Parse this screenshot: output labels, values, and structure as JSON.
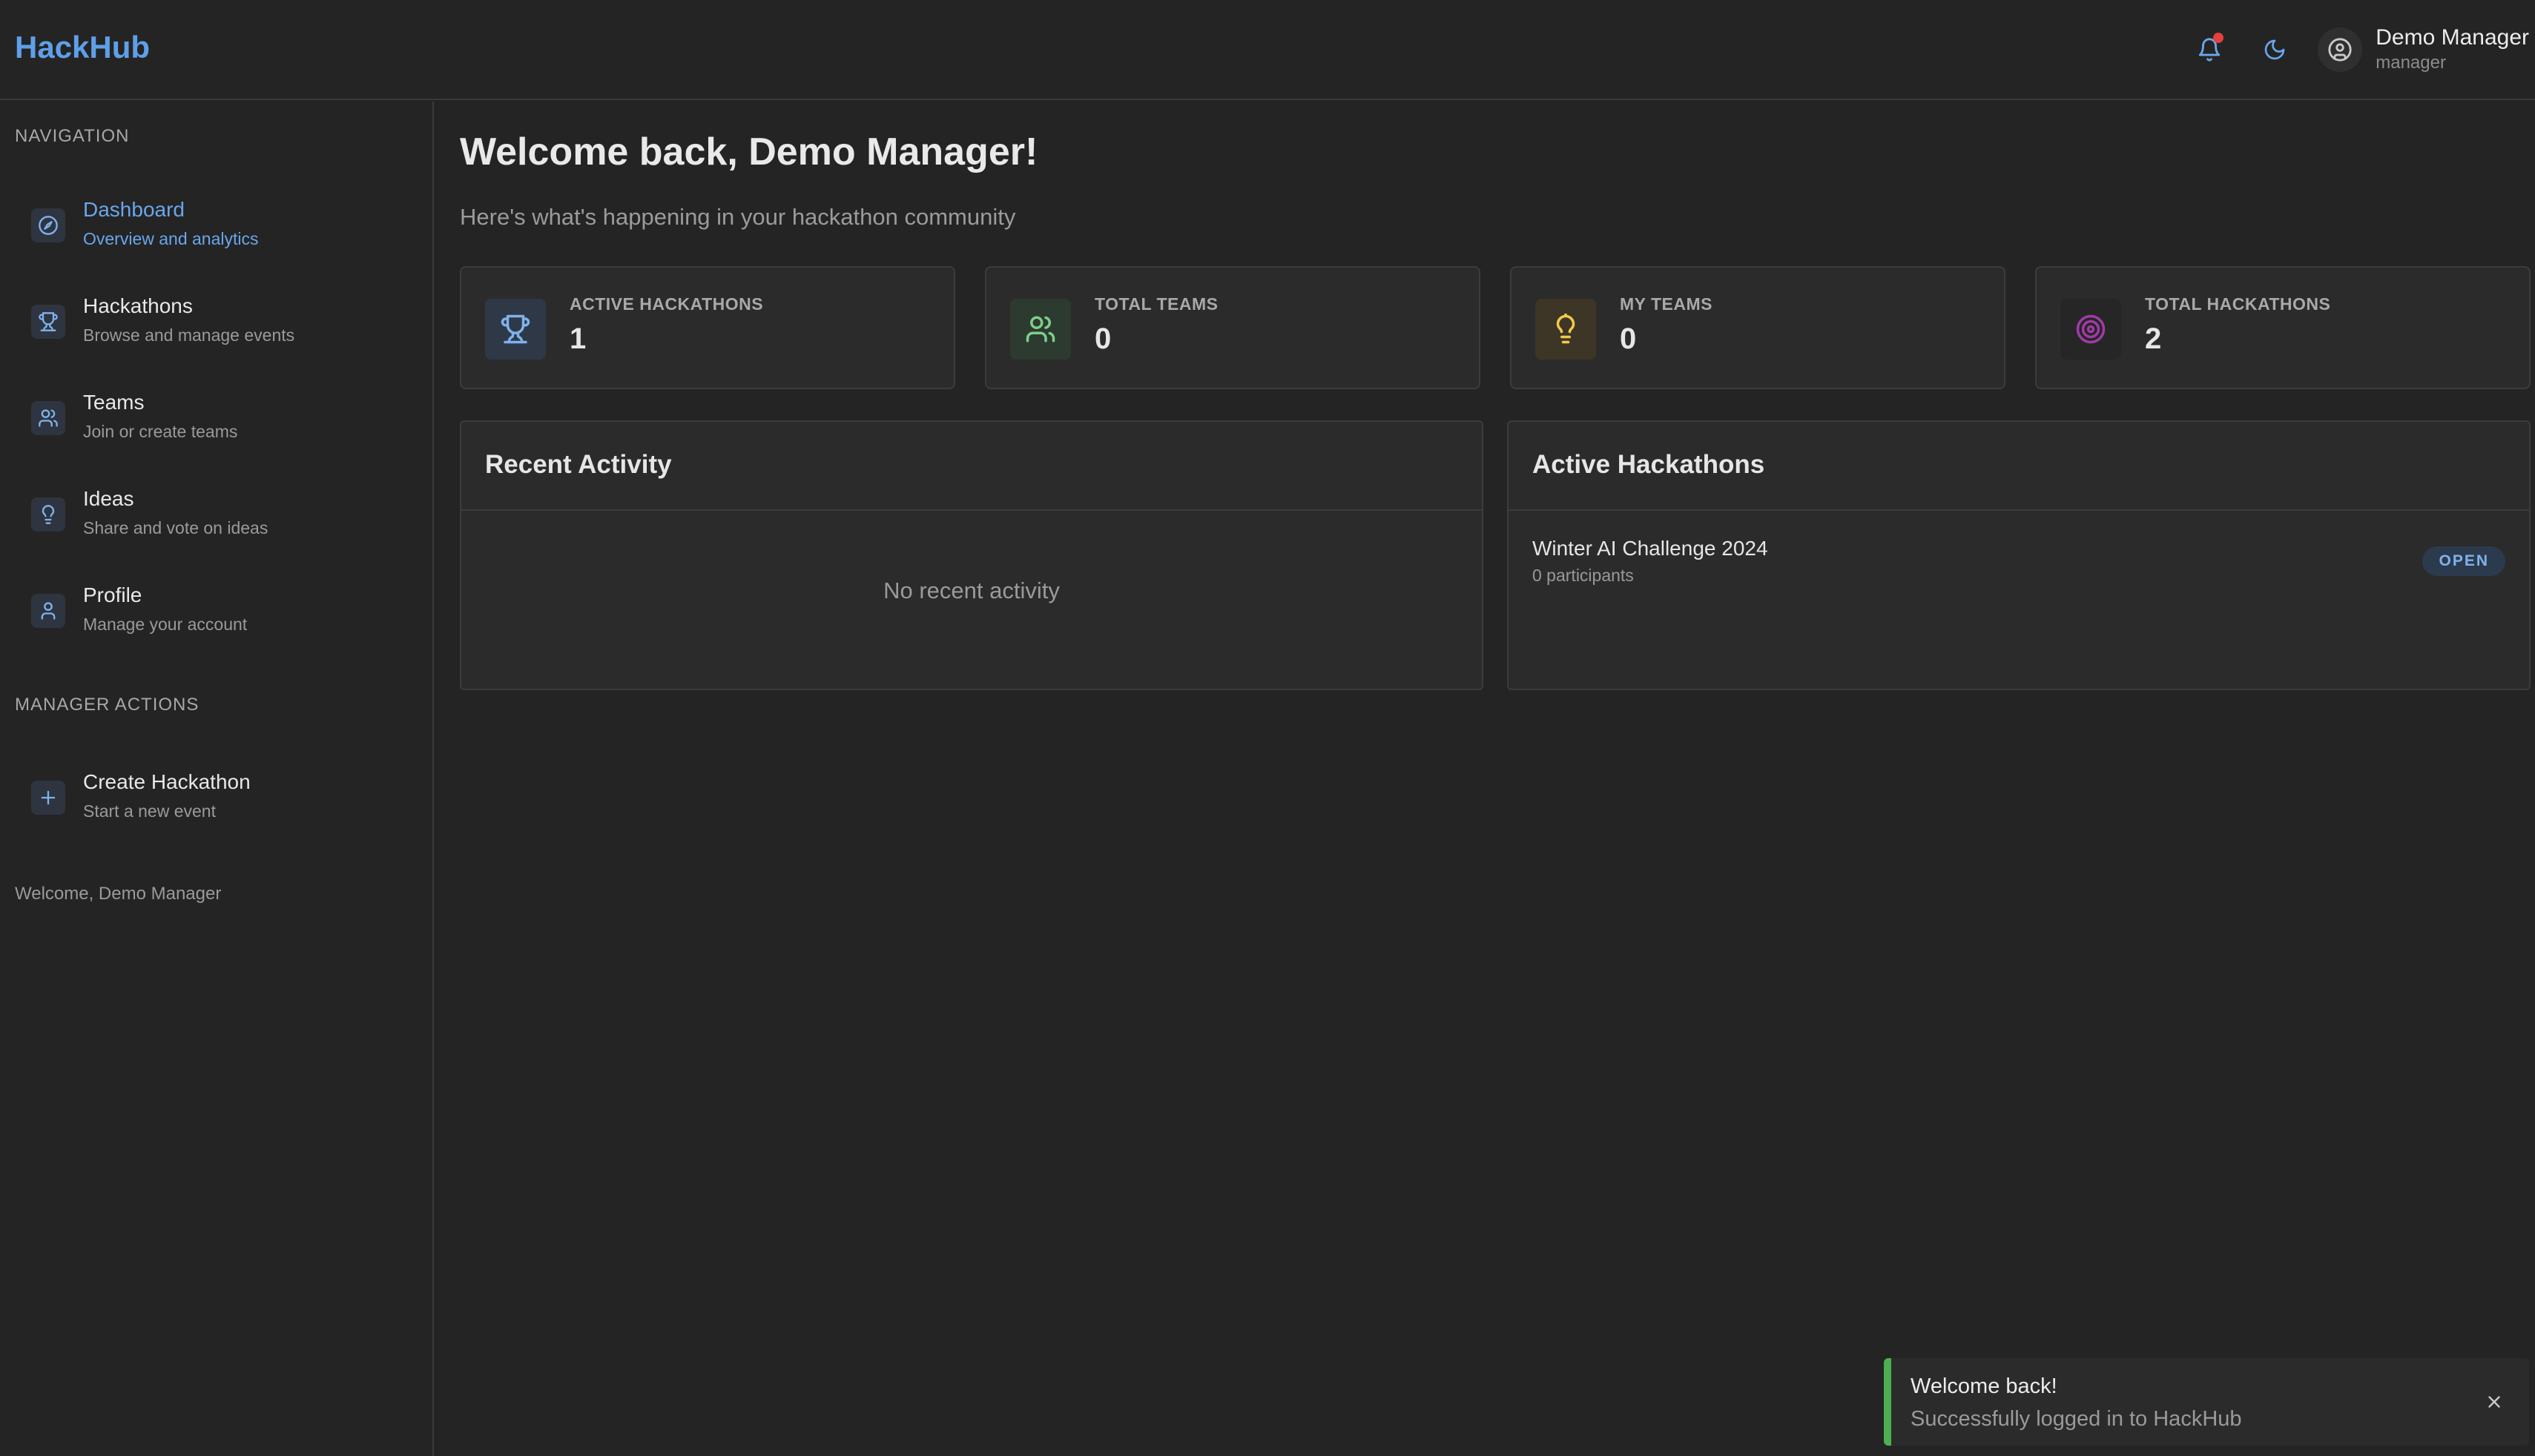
{
  "app": {
    "logo": "HackHub"
  },
  "user": {
    "name": "Demo Manager",
    "role": "manager"
  },
  "header_icons": [
    "bell-icon",
    "moon-icon",
    "user-circle-icon"
  ],
  "sidebar": {
    "navigation_label": "NAVIGATION",
    "items": [
      {
        "title": "Dashboard",
        "subtitle": "Overview and analytics",
        "icon": "dashboard-icon",
        "active": true
      },
      {
        "title": "Hackathons",
        "subtitle": "Browse and manage events",
        "icon": "trophy-icon",
        "active": false
      },
      {
        "title": "Teams",
        "subtitle": "Join or create teams",
        "icon": "users-icon",
        "active": false
      },
      {
        "title": "Ideas",
        "subtitle": "Share and vote on ideas",
        "icon": "lightbulb-icon",
        "active": false
      },
      {
        "title": "Profile",
        "subtitle": "Manage your account",
        "icon": "user-icon",
        "active": false
      }
    ],
    "manager_label": "MANAGER ACTIONS",
    "manager_items": [
      {
        "title": "Create Hackathon",
        "subtitle": "Start a new event",
        "icon": "plus-icon"
      }
    ],
    "welcome": "Welcome, Demo Manager"
  },
  "main": {
    "title": "Welcome back, Demo Manager!",
    "subtitle": "Here's what's happening in your hackathon community",
    "stats": [
      {
        "label": "ACTIVE HACKATHONS",
        "value": "1",
        "icon": "trophy-icon",
        "color": "#7fb2ec"
      },
      {
        "label": "TOTAL TEAMS",
        "value": "0",
        "icon": "users-icon",
        "color": "#7ccf8a"
      },
      {
        "label": "MY TEAMS",
        "value": "0",
        "icon": "lightbulb-icon",
        "color": "#f2c94c"
      },
      {
        "label": "TOTAL HACKATHONS",
        "value": "2",
        "icon": "target-icon",
        "color": "#a23aa8"
      }
    ],
    "recent_activity": {
      "title": "Recent Activity",
      "empty": "No recent activity"
    },
    "active_hackathons": {
      "title": "Active Hackathons",
      "items": [
        {
          "name": "Winter AI Challenge 2024",
          "participants": "0 participants",
          "status": "OPEN"
        }
      ]
    }
  },
  "toast": {
    "title": "Welcome back!",
    "message": "Successfully logged in to HackHub",
    "accent": "#4caf50"
  }
}
